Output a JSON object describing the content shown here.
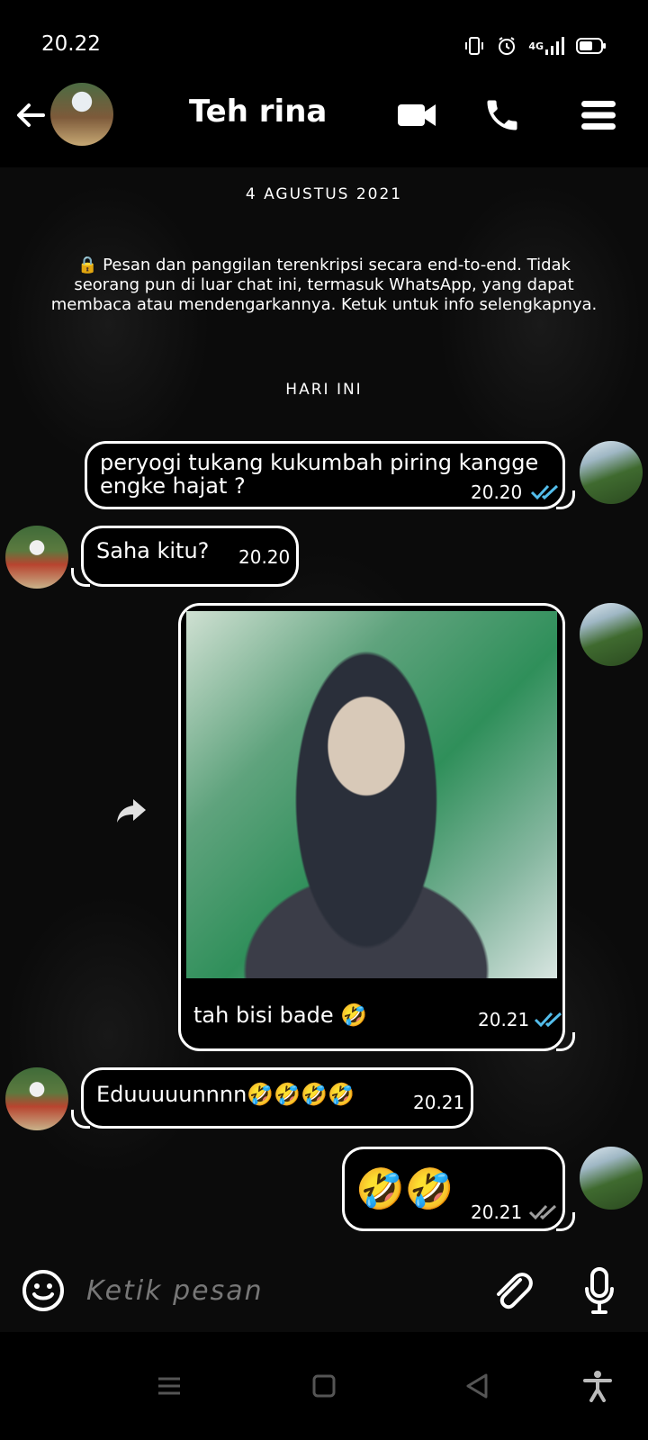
{
  "status_bar": {
    "time": "20.22",
    "network": "4G"
  },
  "header": {
    "contact_name": "Teh rina"
  },
  "chat": {
    "date_label": "4 AGUSTUS 2021",
    "encryption_notice": "🔒 Pesan dan panggilan terenkripsi secara end-to-end. Tidak seorang pun di luar chat ini, termasuk WhatsApp, yang dapat membaca atau mendengarkannya. Ketuk untuk info selengkapnya.",
    "today_label": "HARI INI",
    "messages": [
      {
        "from": "me",
        "text": "peryogi tukang kukumbah piring kangge engke hajat ?",
        "time": "20.20",
        "status": "read"
      },
      {
        "from": "them",
        "text": "Saha kitu?",
        "time": "20.20"
      },
      {
        "from": "me",
        "type": "image",
        "caption": "tah bisi bade 🤣",
        "time": "20.21",
        "status": "read"
      },
      {
        "from": "them",
        "text": "Eduuuuunnnn🤣🤣🤣🤣",
        "time": "20.21"
      },
      {
        "from": "me",
        "text": "🤣🤣",
        "time": "20.21",
        "status": "delivered"
      }
    ]
  },
  "input": {
    "placeholder": "Ketik pesan"
  },
  "colors": {
    "read_tick": "#53bdeb",
    "delivered_tick": "#9e9e9e",
    "bubble_border": "#ffffff",
    "background": "#0b0b0b"
  }
}
